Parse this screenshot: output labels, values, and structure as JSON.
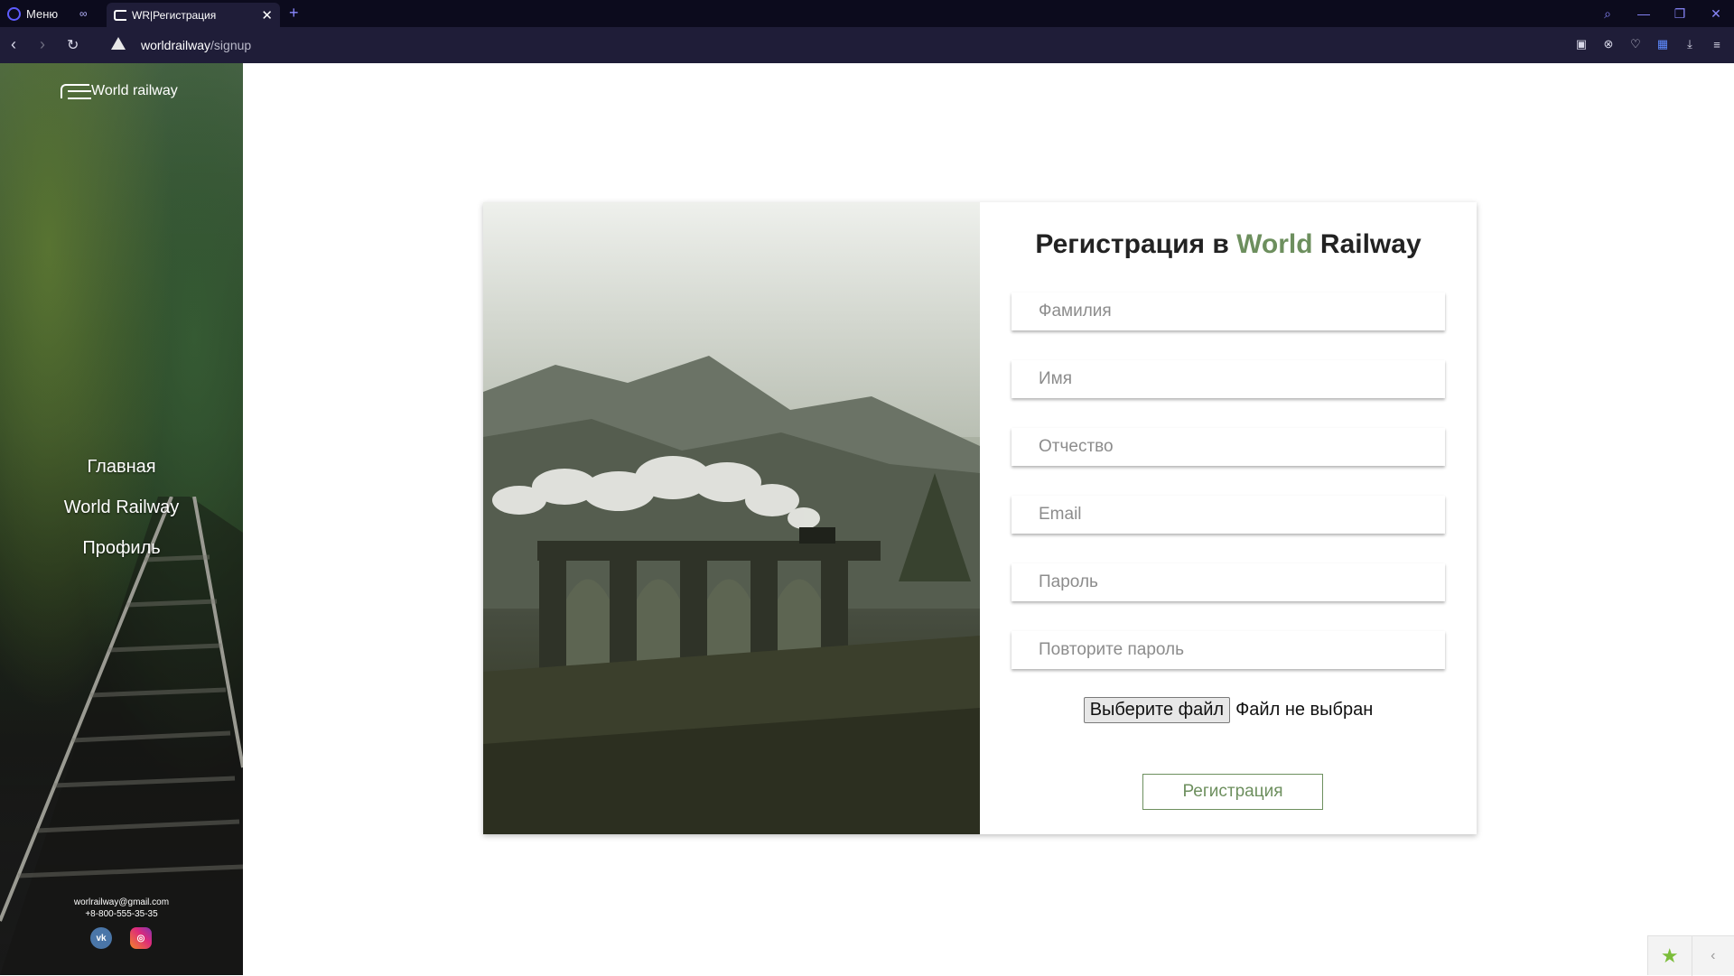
{
  "browser": {
    "menu_label": "Меню",
    "tab_title": "WR|Регистрация",
    "url_host": "worldrailway",
    "url_path": "/signup"
  },
  "sidebar": {
    "brand": "World railway",
    "nav": [
      {
        "label": "Главная"
      },
      {
        "label": "World Railway"
      },
      {
        "label": "Профиль"
      }
    ],
    "email": "worlrailway@gmail.com",
    "phone": "+8-800-555-35-35",
    "socials": [
      "vk-icon",
      "instagram-icon"
    ]
  },
  "form": {
    "title_prefix": "Регистрация в ",
    "title_accent": "World",
    "title_suffix": " Railway",
    "fields": {
      "last_name": {
        "placeholder": "Фамилия",
        "value": ""
      },
      "first_name": {
        "placeholder": "Имя",
        "value": ""
      },
      "patronymic": {
        "placeholder": "Отчество",
        "value": ""
      },
      "email": {
        "placeholder": "Email",
        "value": ""
      },
      "password": {
        "placeholder": "Пароль",
        "value": ""
      },
      "password_repeat": {
        "placeholder": "Повторите пароль",
        "value": ""
      }
    },
    "file_button": "Выберите файл",
    "file_status": "Файл не выбран",
    "submit": "Регистрация"
  },
  "colors": {
    "accent_green": "#6d8f5e",
    "browser_dark": "#0c0b1d",
    "browser_bar": "#1f1d38"
  }
}
